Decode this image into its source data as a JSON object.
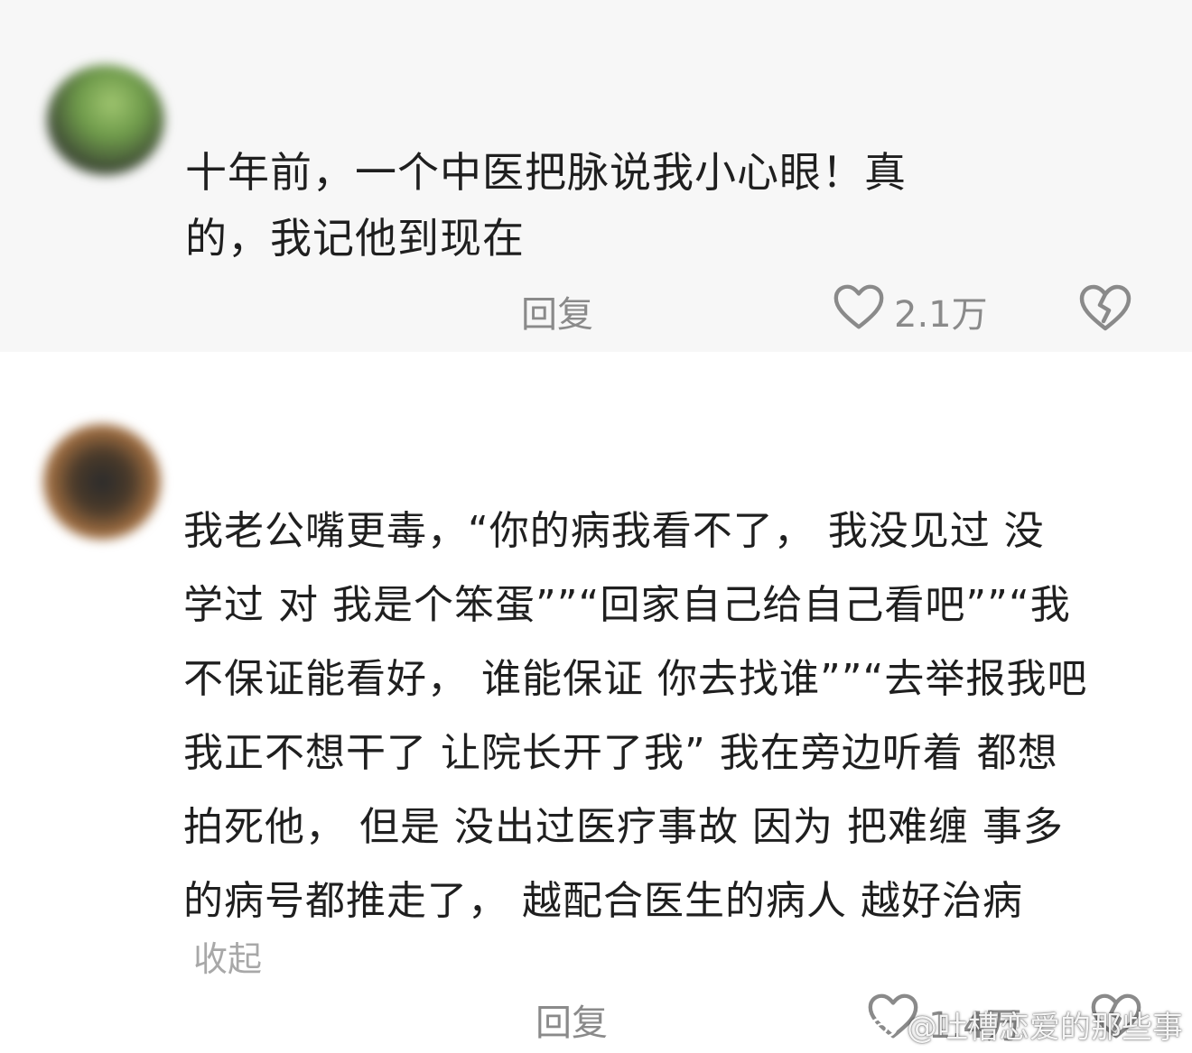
{
  "comments": [
    {
      "text_lines": [
        "十年前，一个中医把脉说我小心眼！真",
        "的，我记他到现在"
      ],
      "reply_label": "回复",
      "like_count": "2.1万"
    },
    {
      "text_lines": [
        "我老公嘴更毒，“你的病我看不了， 我没见过 没",
        "学过  对 我是个笨蛋””“回家自己给自己看吧””“我",
        "不保证能看好， 谁能保证 你去找谁””“去举报我吧",
        "我正不想干了 让院长开了我” 我在旁边听着 都想",
        "拍死他， 但是 没出过医疗事故 因为 把难缠 事多",
        "的病号都推走了， 越配合医生的病人 越好治病"
      ],
      "collapse_label": "收起",
      "reply_label": "回复",
      "like_count": "1.4万"
    }
  ],
  "watermark": {
    "text": "@吐槽恋爱的那些事"
  },
  "colors": {
    "text": "#1f1f1f",
    "meta": "#8a8a8a",
    "collapse": "#a8a8a8",
    "first_comment_bg": "#f7f7f7"
  },
  "icons": [
    "heart-outline-icon",
    "broken-heart-icon",
    "weibo-logo-icon"
  ]
}
